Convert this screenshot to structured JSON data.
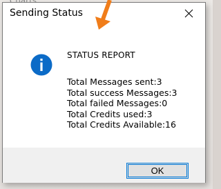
{
  "background": {
    "snippet": " Charts:"
  },
  "dialog": {
    "title": "Sending Status",
    "close_icon": "close-icon",
    "message_icon": "info-icon",
    "heading": "STATUS REPORT",
    "lines": [
      "Total Messages sent:3",
      "Total success Messages:3",
      "Total failed Messages:0",
      "Total Credits used:3",
      "Total Credits Available:16"
    ],
    "ok_label": "OK"
  },
  "annotation": {
    "icon": "arrow-down-icon",
    "color": "#f07d1a"
  },
  "colors": {
    "info_blue": "#0c6bc7",
    "button_border": "#0078d7",
    "footer_bg": "#f0f0f0"
  }
}
